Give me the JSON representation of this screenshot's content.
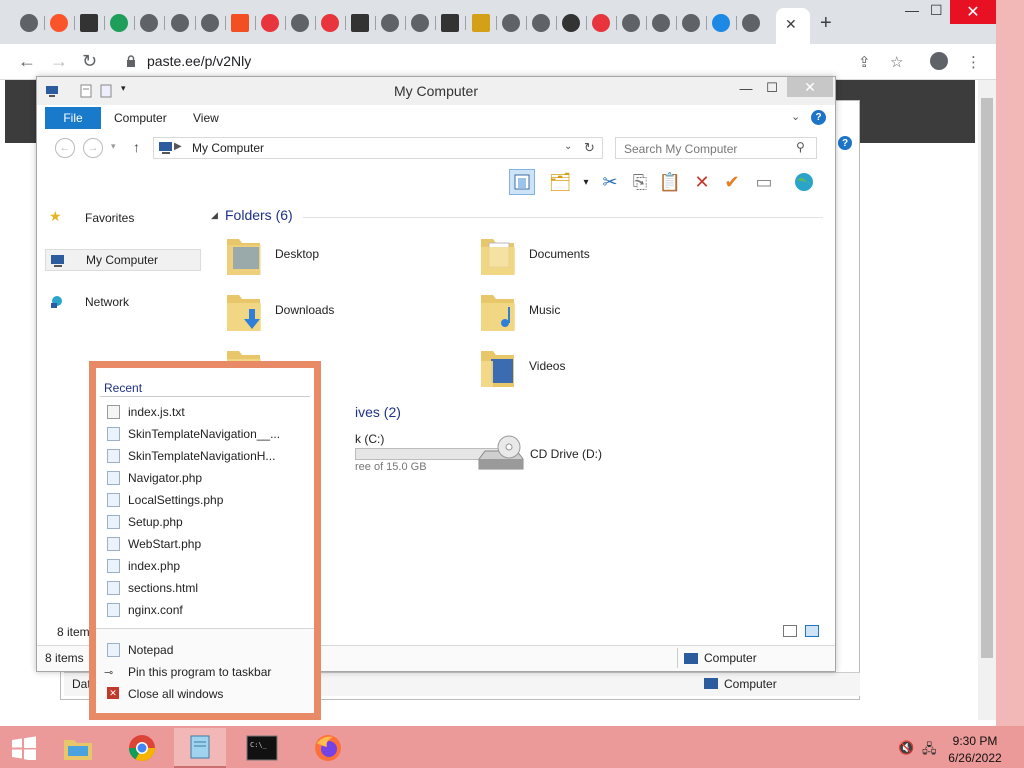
{
  "browser": {
    "url": "paste.ee/p/v2Nly",
    "tabs": [
      {
        "icon": "chrome-icon"
      },
      {
        "icon": "brave-icon"
      },
      {
        "icon": "sql-icon"
      },
      {
        "icon": "n-icon"
      },
      {
        "icon": "download-icon"
      },
      {
        "icon": "chrome-icon"
      },
      {
        "icon": "chrome-icon"
      },
      {
        "icon": "windows-icon"
      },
      {
        "icon": "opera-icon"
      },
      {
        "icon": "chrome-icon"
      },
      {
        "icon": "store-icon"
      },
      {
        "icon": "sql-icon"
      },
      {
        "icon": "chrome-icon"
      },
      {
        "icon": "diamond-icon"
      },
      {
        "icon": "sql-icon"
      },
      {
        "icon": "bookmark-icon"
      },
      {
        "icon": "gear-icon"
      },
      {
        "icon": "chrome-icon"
      },
      {
        "icon": "wikipedia-icon"
      },
      {
        "icon": "opera-icon"
      },
      {
        "icon": "chrome-icon"
      },
      {
        "icon": "chrome-icon"
      },
      {
        "icon": "gear-icon"
      },
      {
        "icon": "cloud-icon"
      },
      {
        "icon": "chrome-icon"
      }
    ],
    "close_glyph": "✕",
    "new_tab_glyph": "+"
  },
  "background_window": {
    "status_left": "Dat",
    "status_right": "Computer"
  },
  "explorer": {
    "title": "My Computer",
    "ribbon": {
      "file": "File",
      "tabs": [
        "Computer",
        "View"
      ]
    },
    "address": "My Computer",
    "search_placeholder": "Search My Computer",
    "nav": {
      "favorites": "Favorites",
      "my_computer": "My Computer",
      "network": "Network"
    },
    "folders_header": "Folders (6)",
    "folders": [
      {
        "name": "Desktop"
      },
      {
        "name": "Documents"
      },
      {
        "name": "Downloads"
      },
      {
        "name": "Music"
      },
      {
        "name": "Videos"
      }
    ],
    "drives_header_visible": "ives (2)",
    "drive_c_label_visible": "k (C:)",
    "drive_c_free_visible": "ree of 15.0 GB",
    "drive_d_label": "CD Drive (D:)",
    "status_items_visible": "8 item",
    "bottom_items": "8 items",
    "bottom_location": "Computer"
  },
  "jumplist": {
    "section": "Recent",
    "recent": [
      "index.js.txt",
      "SkinTemplateNavigation__...",
      "SkinTemplateNavigationH...",
      "Navigator.php",
      "LocalSettings.php",
      "Setup.php",
      "WebStart.php",
      "index.php",
      "sections.html",
      "nginx.conf"
    ],
    "tasks": {
      "app": "Notepad",
      "pin": "Pin this program to taskbar",
      "close": "Close all windows"
    }
  },
  "taskbar": {
    "time": "9:30 PM",
    "date": "6/26/2022"
  }
}
